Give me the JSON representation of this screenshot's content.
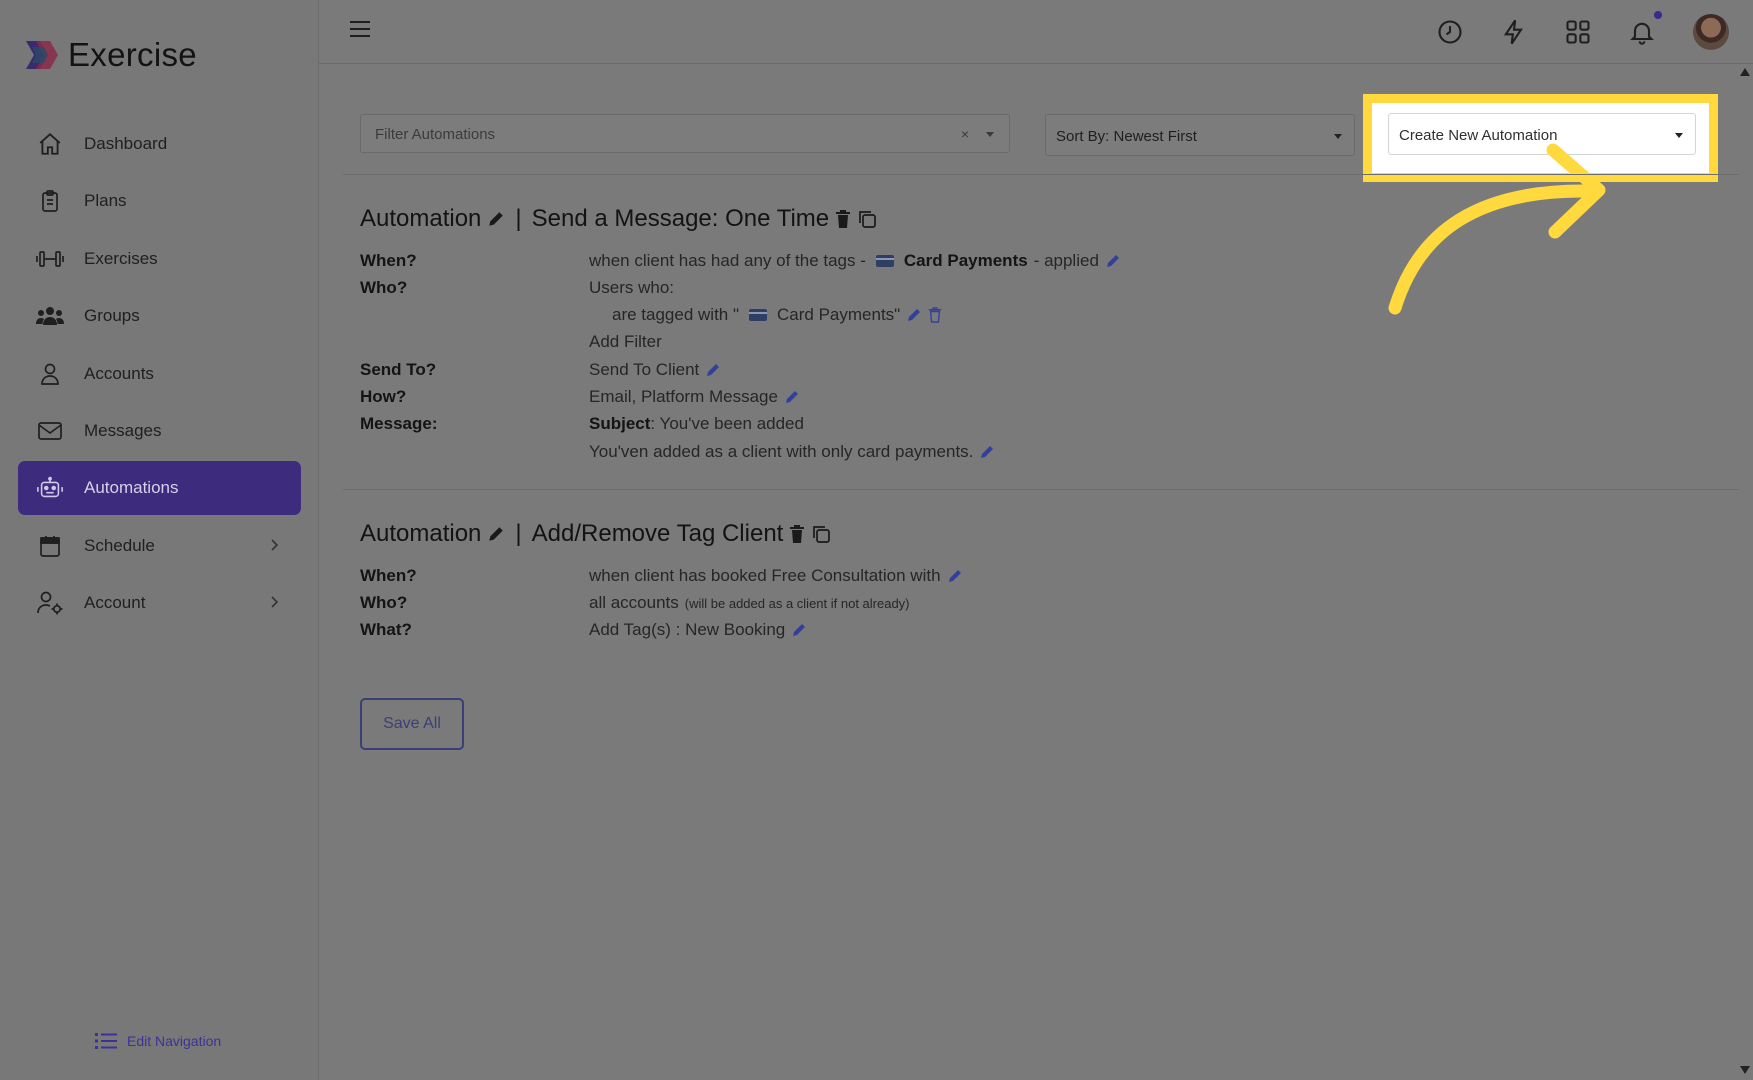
{
  "app": {
    "name": "Exercise"
  },
  "sidebar": {
    "items": [
      {
        "label": "Dashboard",
        "icon": "home-icon"
      },
      {
        "label": "Plans",
        "icon": "clipboard-icon"
      },
      {
        "label": "Exercises",
        "icon": "dumbbell-icon"
      },
      {
        "label": "Groups",
        "icon": "users-icon"
      },
      {
        "label": "Accounts",
        "icon": "user-icon"
      },
      {
        "label": "Messages",
        "icon": "envelope-icon"
      },
      {
        "label": "Automations",
        "icon": "robot-icon",
        "active": true
      },
      {
        "label": "Schedule",
        "icon": "calendar-icon",
        "expandable": true
      },
      {
        "label": "Account",
        "icon": "user-gear-icon",
        "expandable": true
      }
    ],
    "edit_navigation": "Edit Navigation"
  },
  "toolbar": {
    "filter_placeholder": "Filter Automations",
    "clear_symbol": "×",
    "sort_label": "Sort By: Newest First",
    "create_label": "Create New Automation"
  },
  "automations": [
    {
      "title_prefix": "Automation",
      "title": "Send a Message: One Time",
      "when_label": "When?",
      "when_text": "when client has had any of the tags -",
      "when_tag": "Card Payments",
      "when_suffix": "- applied",
      "who_label": "Who?",
      "who_text": "Users who:",
      "who_filter_prefix": "are tagged with \"",
      "who_filter_tag": "Card Payments\"",
      "add_filter": "Add Filter",
      "send_to_label": "Send To?",
      "send_to_value": "Send To Client",
      "how_label": "How?",
      "how_value": "Email, Platform Message",
      "message_label": "Message:",
      "subject_label": "Subject",
      "subject_value": ": You've been added",
      "message_body": "You'ven added as a client with only card payments."
    },
    {
      "title_prefix": "Automation",
      "title": "Add/Remove Tag Client",
      "when_label": "When?",
      "when_text": "when client has booked Free Consultation with",
      "who_label": "Who?",
      "who_text": "all accounts",
      "who_note": "(will be added as a client if not already)",
      "what_label": "What?",
      "what_value": "Add Tag(s) : New Booking"
    }
  ],
  "save_all": "Save All",
  "colors": {
    "highlight": "#ffd93e",
    "active_nav": "#3d2b7d",
    "overlay": "#7a7a7a"
  }
}
